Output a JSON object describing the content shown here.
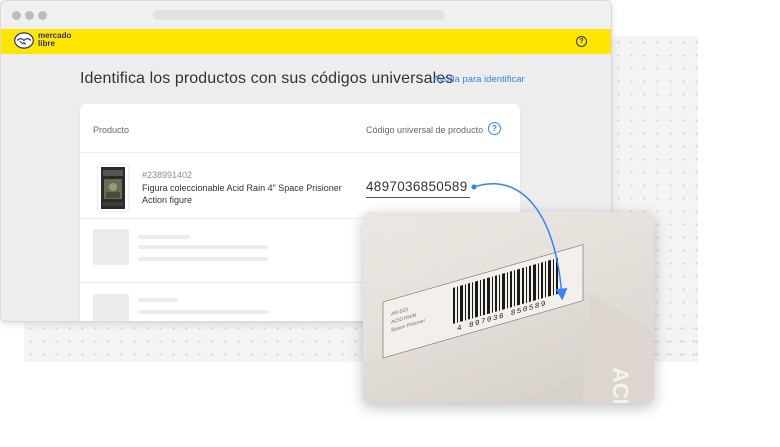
{
  "header": {
    "logo_text": "mercado\nlibre",
    "help_icon": "question-circle-icon"
  },
  "page": {
    "title": "Identifica los productos con sus códigos universales",
    "help_link": "Ayuda para identificar"
  },
  "table": {
    "col_product": "Producto",
    "col_code": "Código universal de producto",
    "col_code_help_icon": "question-circle-icon",
    "rows": [
      {
        "sku": "#238991402",
        "name": "Figura coleccionable Acid Rain 4\" Space Prisioner Action figure",
        "code": "4897036850589"
      }
    ]
  },
  "zoom": {
    "label_lines": [
      "AR-023",
      "ACID RAIN",
      "Space Prisoner"
    ],
    "barcode_text": "4 897036 850589",
    "box_side_text": "ACID WO"
  },
  "colors": {
    "brand_yellow": "#ffe600",
    "link_blue": "#3483fa",
    "logo_blue": "#2d3277"
  }
}
